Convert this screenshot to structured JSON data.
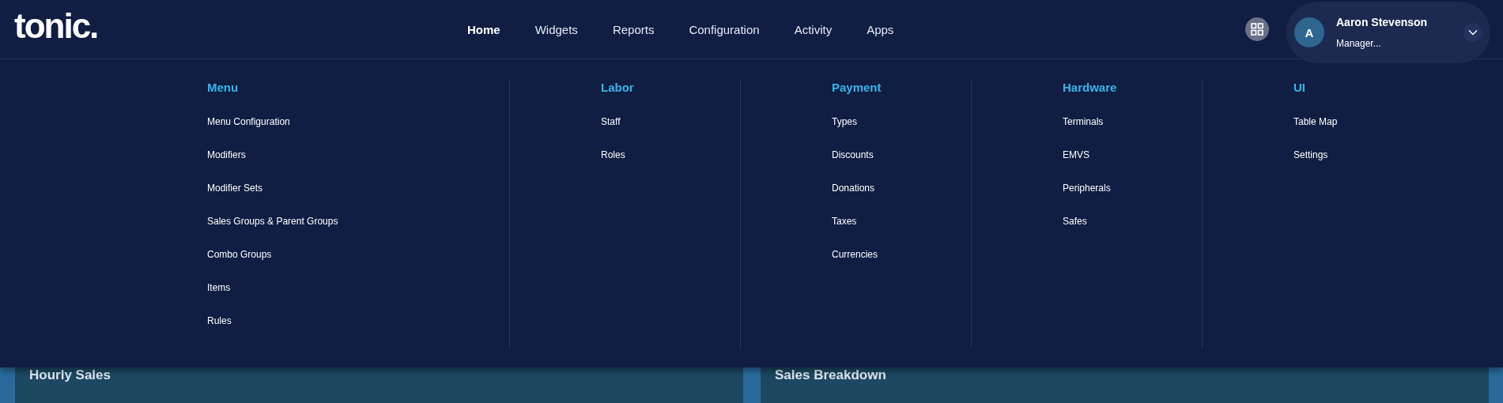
{
  "logo": "tonic.",
  "nav": [
    {
      "label": "Home",
      "selected": true
    },
    {
      "label": "Widgets",
      "selected": false
    },
    {
      "label": "Reports",
      "selected": false
    },
    {
      "label": "Configuration",
      "selected": false
    },
    {
      "label": "Activity",
      "selected": false
    },
    {
      "label": "Apps",
      "selected": false
    }
  ],
  "user": {
    "initial": "A",
    "name": "Aaron Stevenson",
    "role": "Manager..."
  },
  "mega_menu": [
    {
      "heading": "Menu",
      "items": [
        "Menu Configuration",
        "Modifiers",
        "Modifier Sets",
        "Sales Groups & Parent Groups",
        "Combo Groups",
        "Items",
        "Rules"
      ]
    },
    {
      "heading": "Labor",
      "items": [
        "Staff",
        "Roles"
      ]
    },
    {
      "heading": "Payment",
      "items": [
        "Types",
        "Discounts",
        "Donations",
        "Taxes",
        "Currencies"
      ]
    },
    {
      "heading": "Hardware",
      "items": [
        "Terminals",
        "EMVS",
        "Peripherals",
        "Safes"
      ]
    },
    {
      "heading": "UI",
      "items": [
        "Table Map",
        "Settings"
      ]
    }
  ],
  "cards": [
    {
      "title": "Hourly Sales"
    },
    {
      "title": "Sales Breakdown"
    }
  ]
}
